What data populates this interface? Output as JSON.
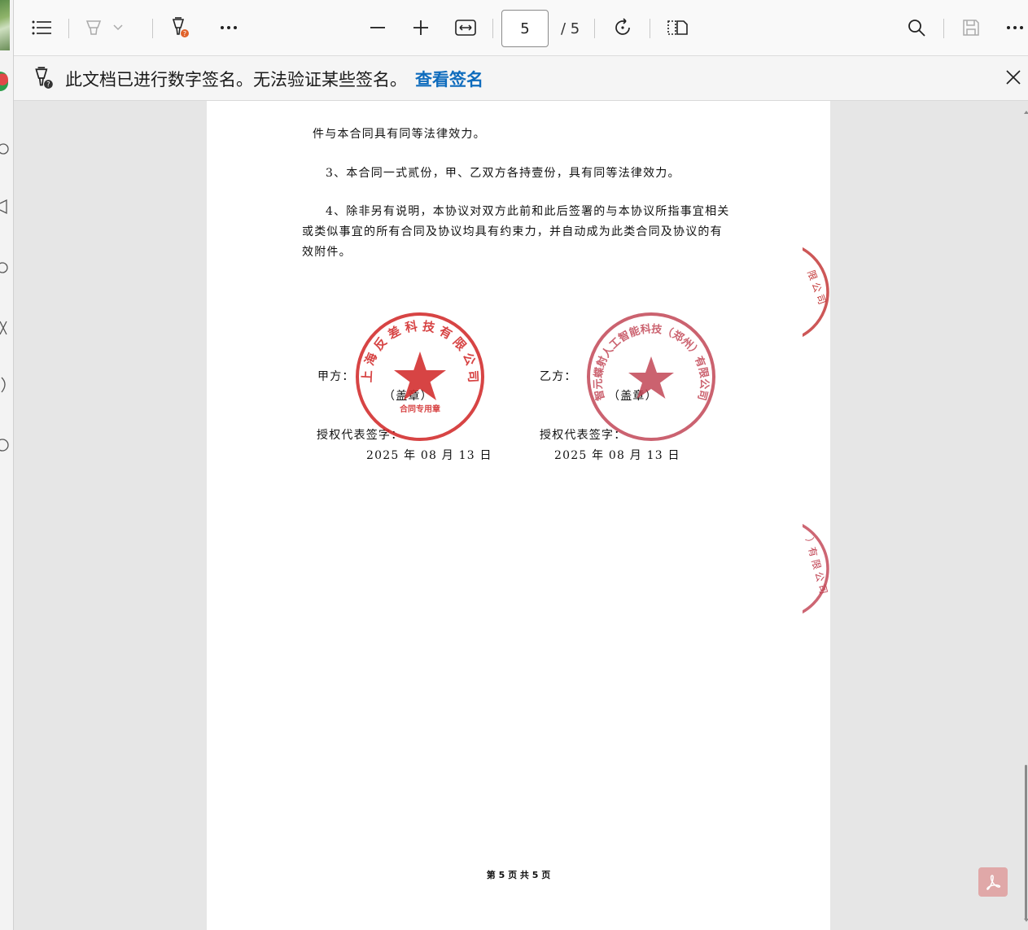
{
  "toolbar": {
    "current_page": "5",
    "total_pages": "/ 5"
  },
  "infobar": {
    "message": "此文档已进行数字签名。无法验证某些签名。",
    "link_label": "查看签名"
  },
  "document": {
    "line1": "件与本合同具有同等法律效力。",
    "clause3": "3、本合同一式贰份，甲、乙双方各持壹份，具有同等法律效力。",
    "clause4_line1": "4、除非另有说明，本协议对双方此前和此后签署的与本协议所指事宜相关",
    "clause4_line2": "或类似事宜的所有合同及协议均具有约束力，并自动成为此类合同及协议的有",
    "clause4_line3": "效附件。",
    "party_a": {
      "label": "甲方：",
      "stamp_note": "（盖章）",
      "rep_label": "授权代表签字：",
      "date": "2025 年  08 月 13  日"
    },
    "party_b": {
      "label": "乙方：",
      "stamp_note": "（盖章）",
      "rep_label": "授权代表签字：",
      "date": "2025  年 08   月 13   日"
    },
    "seal_a": {
      "text": "上 海 反 差 科 技 有 限 公 司",
      "sub": "合同专用章",
      "color": "#d22b2b"
    },
    "seal_b": {
      "text": "智元蝶射人工智能科技（郑州）有限公司",
      "color": "#c04050"
    },
    "edge_seal_top_text": "限 公 司",
    "edge_seal_bottom_text": "）有 限 公 司",
    "footer": "第 5 页  共 5 页"
  },
  "colors": {
    "link": "#0f6cbd",
    "seal_red": "#d22b2b"
  }
}
